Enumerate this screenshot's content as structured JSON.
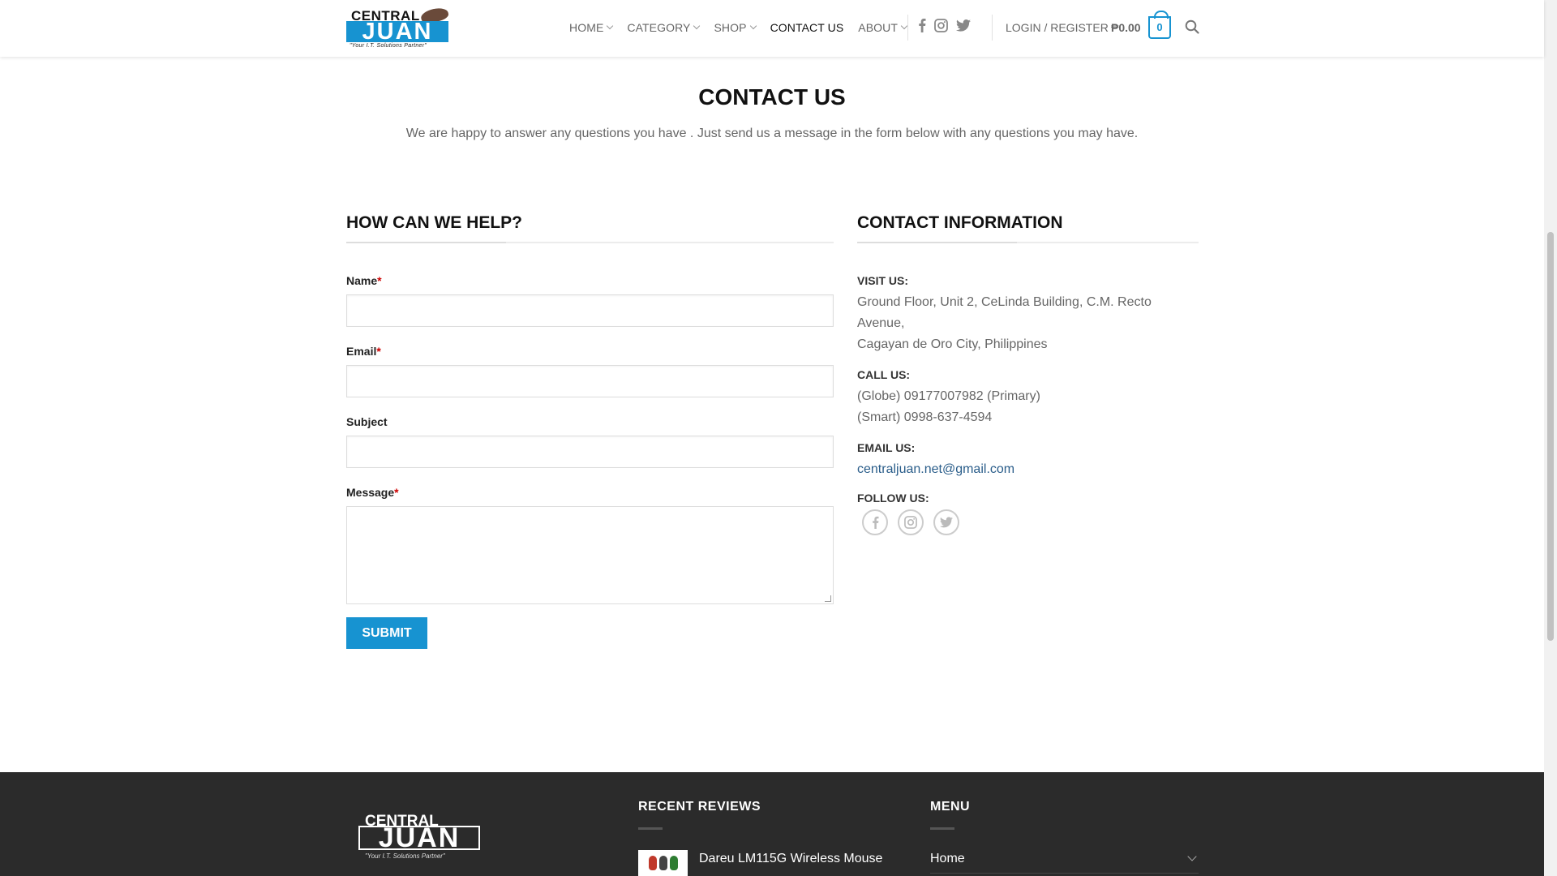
{
  "header": {
    "logo": {
      "top_text": "CENTRAL",
      "main_text": "JUAN",
      "tagline": "\"Your I.T. Solutions Partner\""
    },
    "nav": [
      {
        "label": "HOME",
        "dropdown": true
      },
      {
        "label": "CATEGORY",
        "dropdown": true
      },
      {
        "label": "SHOP",
        "dropdown": true
      },
      {
        "label": "CONTACT US",
        "dropdown": false,
        "active": true
      },
      {
        "label": "ABOUT",
        "dropdown": true
      }
    ],
    "social_icons": [
      "facebook-icon",
      "instagram-icon",
      "twitter-icon"
    ],
    "login_label": "LOGIN / REGISTER",
    "cart_total": "₱0.00",
    "cart_count": "0"
  },
  "page": {
    "title": "CONTACT US",
    "intro": "We are happy to answer any questions you have . Just send us a message in the form below with any questions you may have."
  },
  "form": {
    "heading": "HOW CAN WE HELP?",
    "fields": {
      "name_label": "Name",
      "email_label": "Email",
      "subject_label": "Subject",
      "message_label": "Message",
      "required_mark": "*"
    },
    "submit_label": "SUBMIT"
  },
  "contact": {
    "heading": "CONTACT INFORMATION",
    "visit_label": "VISIT US:",
    "address_line1": "Ground Floor, Unit 2, CeLinda Building, C.M. Recto Avenue,",
    "address_line2": "Cagayan de Oro City, Philippines",
    "call_label": "CALL US:",
    "phone1": "(Globe) 09177007982 (Primary)",
    "phone2": "(Smart) 0998-637-4594",
    "email_label": "EMAIL US:",
    "email": "centraljuan.net@gmail.com",
    "follow_label": "FOLLOW US:"
  },
  "footer": {
    "logo": {
      "top_text": "CENTRAL",
      "main_text": "JUAN",
      "tagline": "\"Your I.T. Solutions Partner\""
    },
    "reviews_heading": "RECENT REVIEWS",
    "review_item": "Dareu LM115G Wireless Mouse",
    "menu_heading": "MENU",
    "menu_item": "Home"
  },
  "colors": {
    "accent": "#1793d1",
    "footer_bg": "#2b2b2b",
    "required": "#cc0000"
  }
}
